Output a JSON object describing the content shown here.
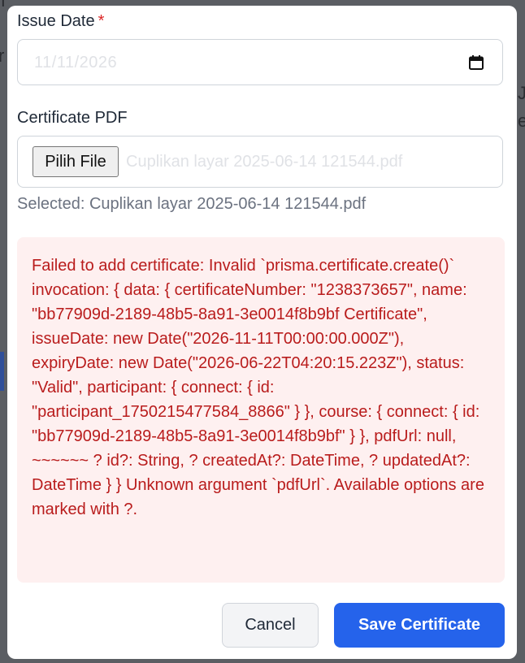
{
  "form": {
    "issue_date": {
      "label": "Issue Date",
      "required_mark": "*",
      "value": "11/11/2026",
      "icon": "calendar-icon"
    },
    "certificate_pdf": {
      "label": "Certificate PDF",
      "button_label": "Pilih File",
      "file_name": "Cuplikan layar 2025-06-14 121544.pdf",
      "selected_text": "Selected: Cuplikan layar 2025-06-14 121544.pdf"
    },
    "error": {
      "message": "Failed to add certificate: Invalid `prisma.certificate.create()` invocation: { data: { certificateNumber: \"1238373657\", name: \"bb77909d-2189-48b5-8a91-3e0014f8b9bf Certificate\", issueDate: new Date(\"2026-11-11T00:00:00.000Z\"), expiryDate: new Date(\"2026-06-22T04:20:15.223Z\"), status: \"Valid\", participant: { connect: { id: \"participant_1750215477584_8866\" } }, course: { connect: { id: \"bb77909d-2189-48b5-8a91-3e0014f8b9bf\" } }, pdfUrl: null, ~~~~~~ ? id?: String, ? createdAt?: DateTime, ? updatedAt?: DateTime } } Unknown argument `pdfUrl`. Available options are marked with ?."
    },
    "actions": {
      "cancel_label": "Cancel",
      "save_label": "Save Certificate"
    }
  },
  "colors": {
    "primary": "#2563eb",
    "error_text": "#b91c1c",
    "error_bg": "#fef0f0",
    "required": "#dc2626"
  }
}
